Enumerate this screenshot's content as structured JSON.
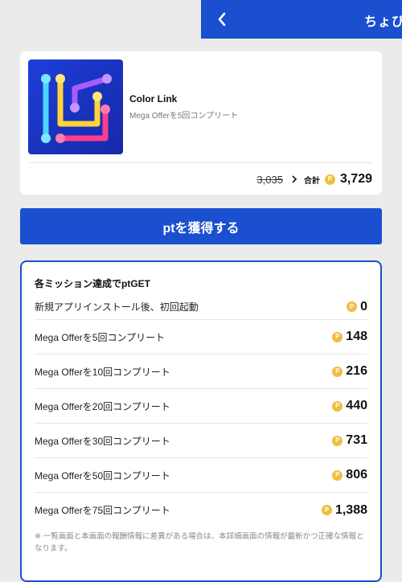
{
  "header": {
    "title": "ちょびリッチ",
    "back_icon": "chevron-left-icon"
  },
  "app": {
    "name": "Color Link",
    "subtitle": "Mega Offerを5回コンプリート",
    "old_price": "3,035",
    "total_label": "合計",
    "coin_symbol": "P",
    "total_value": "3,729"
  },
  "cta": {
    "label": "ptを獲得する"
  },
  "missions": {
    "title": "各ミッション達成でptGET",
    "items": [
      {
        "label": "新規アプリインストール後、初回起動",
        "points": "0"
      },
      {
        "label": "Mega Offerを5回コンプリート",
        "points": "148"
      },
      {
        "label": "Mega Offerを10回コンプリート",
        "points": "216"
      },
      {
        "label": "Mega Offerを20回コンプリート",
        "points": "440"
      },
      {
        "label": "Mega Offerを30回コンプリート",
        "points": "731"
      },
      {
        "label": "Mega Offerを50回コンプリート",
        "points": "806"
      },
      {
        "label": "Mega Offerを75回コンプリート",
        "points": "1,388"
      }
    ],
    "note": "※ 一覧画面と本画面の報酬情報に差異がある場合は、本詳細画面の情報が最新かつ正確な情報となります。"
  },
  "colors": {
    "brand_blue": "#1a4fd0",
    "coin": "#f2bc3d",
    "background": "#ebebeb"
  }
}
